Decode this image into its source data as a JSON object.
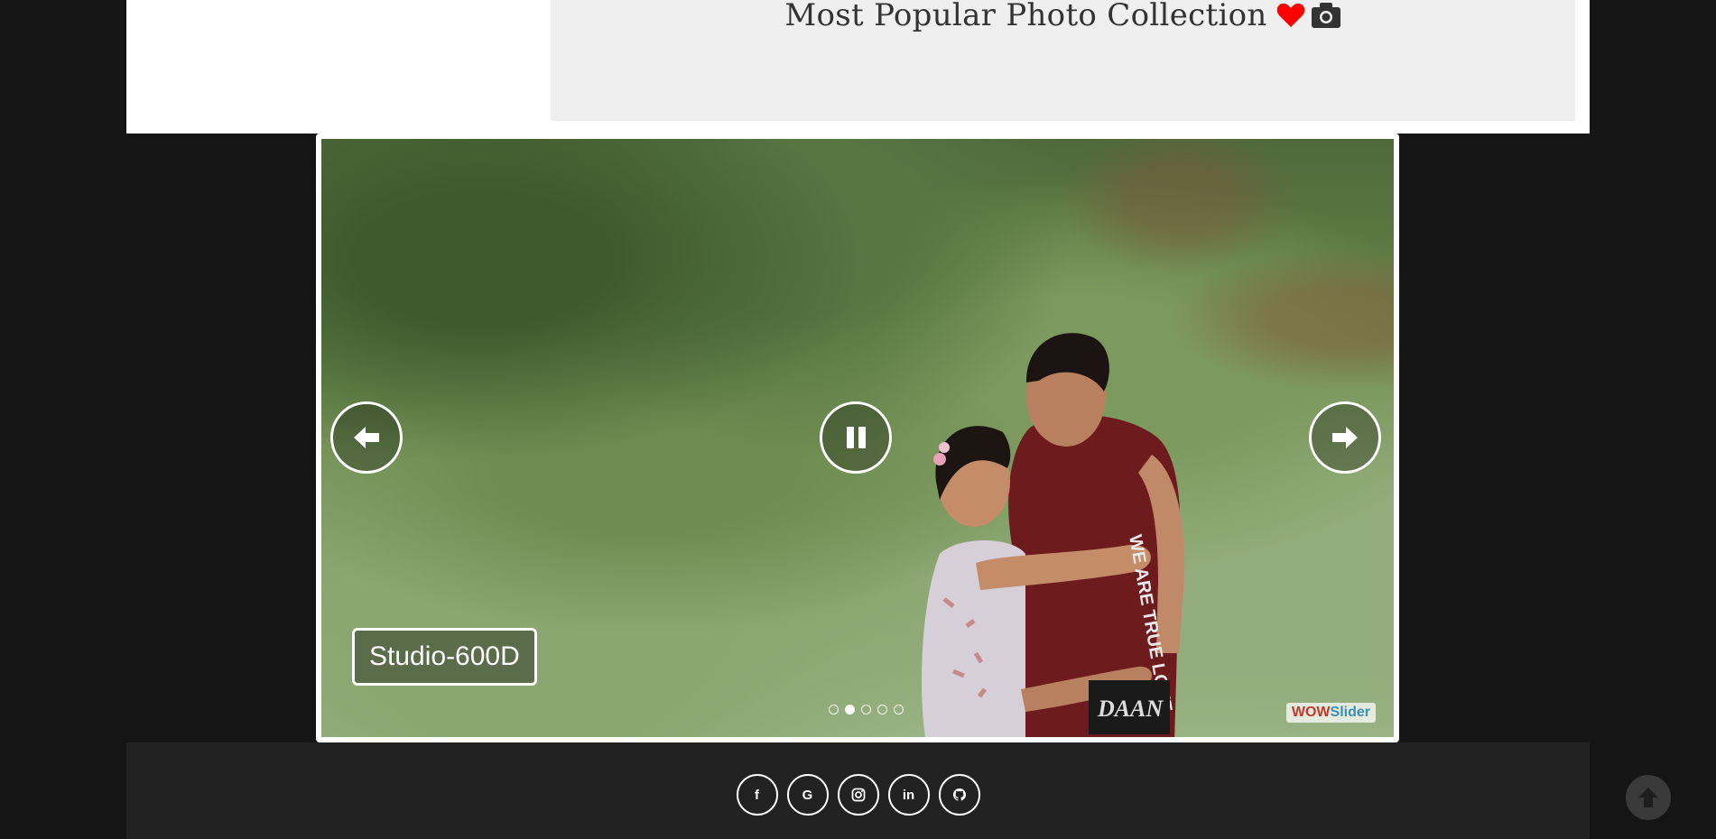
{
  "header": {
    "title": "Most Popular Photo Collection",
    "heart_icon": "heart-icon",
    "camera_icon": "camera-icon",
    "heart_color": "#ff0000"
  },
  "slider": {
    "caption": "Studio-600D",
    "watermark_wow": "WOW",
    "watermark_slider": "Slider",
    "controls": {
      "prev_icon": "arrow-left-icon",
      "pause_icon": "pause-icon",
      "next_icon": "arrow-right-icon"
    },
    "bullets": [
      {
        "index": 1,
        "active": false
      },
      {
        "index": 2,
        "active": true
      },
      {
        "index": 3,
        "active": false
      },
      {
        "index": 4,
        "active": false
      },
      {
        "index": 5,
        "active": false
      }
    ]
  },
  "footer": {
    "social": [
      {
        "name": "facebook",
        "icon": "facebook-icon",
        "glyph": "f"
      },
      {
        "name": "google",
        "icon": "google-icon",
        "glyph": "G"
      },
      {
        "name": "instagram",
        "icon": "instagram-icon",
        "glyph": ""
      },
      {
        "name": "linkedin",
        "icon": "linkedin-icon",
        "glyph": "in"
      },
      {
        "name": "github",
        "icon": "github-icon",
        "glyph": ""
      }
    ],
    "scroll_top_icon": "arrow-up-circle-icon"
  }
}
